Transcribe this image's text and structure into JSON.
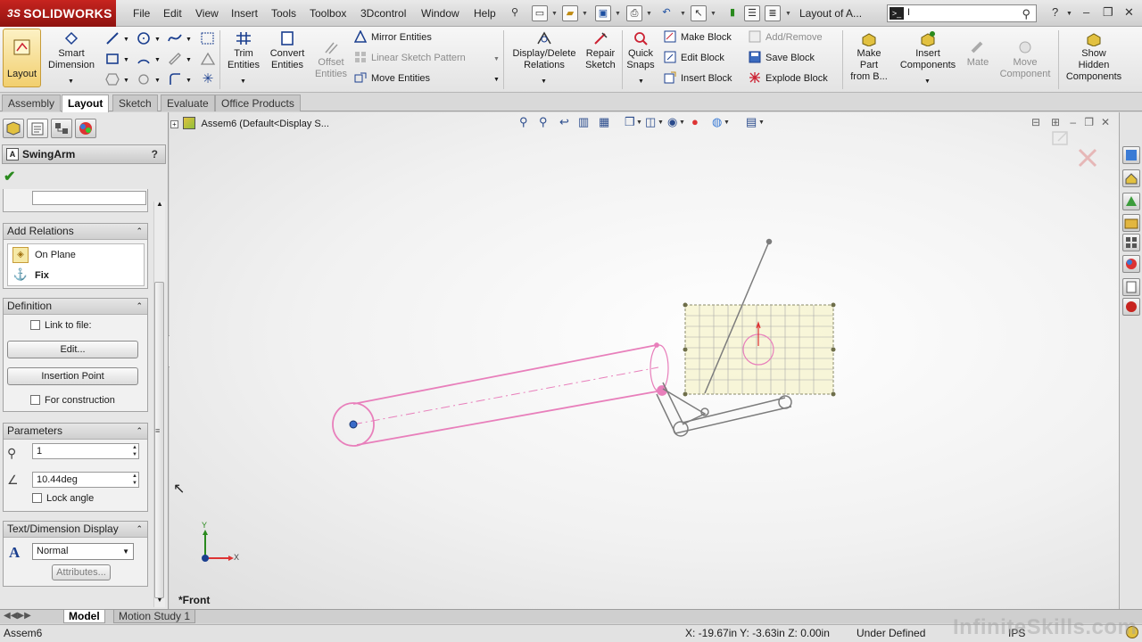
{
  "app": {
    "brand": "SOLIDWORKS",
    "brand_prefix": "3S",
    "doc_title": "Layout of A...",
    "search_value": "I"
  },
  "menu": [
    "File",
    "Edit",
    "View",
    "Insert",
    "Tools",
    "Toolbox",
    "3Dcontrol",
    "Window",
    "Help"
  ],
  "commands": {
    "layout": "Layout",
    "smart_dimension": [
      "Smart",
      "Dimension"
    ],
    "trim_entities": [
      "Trim",
      "Entities"
    ],
    "convert_entities": [
      "Convert",
      "Entities"
    ],
    "offset_entities": [
      "Offset",
      "Entities"
    ],
    "mirror_entities": "Mirror Entities",
    "linear_sketch_pattern": "Linear Sketch Pattern",
    "move_entities": "Move Entities",
    "display_delete_relations": [
      "Display/Delete",
      "Relations"
    ],
    "repair_sketch": [
      "Repair",
      "Sketch"
    ],
    "quick_snaps": [
      "Quick",
      "Snaps"
    ],
    "make_block": "Make Block",
    "edit_block": "Edit Block",
    "insert_block": "Insert Block",
    "add_remove": "Add/Remove",
    "save_block": "Save Block",
    "explode_block": "Explode Block",
    "make_part": [
      "Make",
      "Part",
      "from B..."
    ],
    "insert_components": [
      "Insert",
      "Components"
    ],
    "mate": "Mate",
    "move_component": [
      "Move",
      "Component"
    ],
    "show_hidden": [
      "Show",
      "Hidden",
      "Components"
    ]
  },
  "tabs": [
    "Assembly",
    "Layout",
    "Sketch",
    "Evaluate",
    "Office Products"
  ],
  "active_tab": "Layout",
  "tree": {
    "root": "Assem6  (Default<Display S..."
  },
  "property_manager": {
    "title": "SwingArm",
    "add_relations": {
      "header": "Add Relations",
      "items": [
        "On Plane",
        "Fix"
      ]
    },
    "definition": {
      "header": "Definition",
      "link_to_file": "Link to file:",
      "edit": "Edit...",
      "insertion_point": "Insertion Point",
      "for_construction": "For construction"
    },
    "parameters": {
      "header": "Parameters",
      "scale": "1",
      "angle": "10.44deg",
      "lock_angle": "Lock angle"
    },
    "text_dimension": {
      "header": "Text/Dimension Display",
      "font_style": "Normal",
      "attributes": "Attributes..."
    }
  },
  "viewport": {
    "view_name": "*Front",
    "axis_x": "X",
    "axis_y": "Y"
  },
  "bottom_tabs": [
    "Model",
    "Motion Study 1"
  ],
  "status": {
    "doc": "Assem6",
    "coords": "X: -19.67in Y: -3.63in Z: 0.00in",
    "state": "Under Defined",
    "units": "IPS"
  },
  "watermark": "InfiniteSkills.com",
  "colors": {
    "accent": "#c7241f",
    "sketch_pink": "#e57fb7",
    "block_yellow": "#f4f3c9",
    "selected": "#f2cf6e"
  }
}
